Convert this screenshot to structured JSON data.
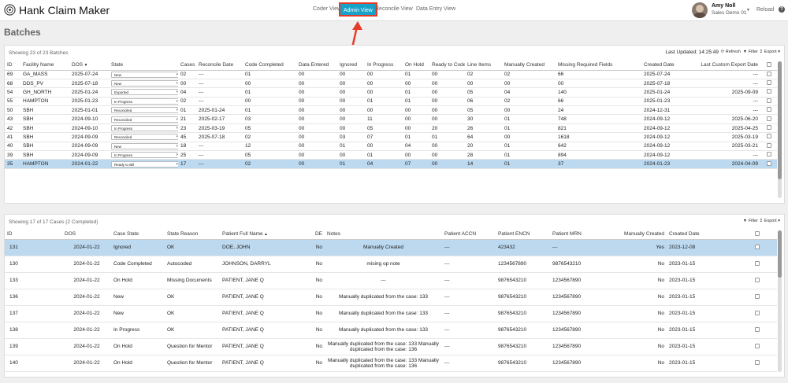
{
  "app": {
    "title": "Hank Claim Maker"
  },
  "nav": {
    "items": [
      {
        "label": "Coder View",
        "active": false
      },
      {
        "label": "Admin View",
        "active": true
      },
      {
        "label": "Reconcile View",
        "active": false
      },
      {
        "label": "Data Entry View",
        "active": false
      }
    ]
  },
  "user": {
    "name": "Amy Noll",
    "subtitle": "Sales Demo 01",
    "reload_label": "Reload",
    "help_label": "?"
  },
  "page": {
    "title": "Batches"
  },
  "batches": {
    "count_text": "Showing 23 of 23 Batches",
    "last_updated": "Last Updated: 14:25:49",
    "refresh_label": "Refresh",
    "filter_label": "Filter",
    "export_label": "Export",
    "columns": [
      "ID",
      "Facility Name",
      "DOS",
      "State",
      "Cases",
      "Reconcile Date",
      "Code Completed",
      "Data Entered",
      "Ignored",
      "In Progress",
      "On Hold",
      "Ready to Code",
      "Line Items",
      "Manually Created",
      "Missing Required Fields",
      "Created Date",
      "Last Custom Export Date"
    ],
    "rows": [
      {
        "id": "69",
        "facility": "GA_MASS",
        "dos": "2025-07-24",
        "state": "New",
        "cases": "02",
        "reconcile": "---",
        "code_completed": "01",
        "data_entered": "00",
        "ignored": "00",
        "in_progress": "00",
        "on_hold": "01",
        "ready_to_code": "00",
        "line_items": "02",
        "manually_created": "02",
        "missing": "66",
        "created": "2025-07-24",
        "last_export": "---",
        "selected": false
      },
      {
        "id": "68",
        "facility": "DDS_PV",
        "dos": "2025-07-18",
        "state": "New",
        "cases": "00",
        "reconcile": "---",
        "code_completed": "00",
        "data_entered": "00",
        "ignored": "00",
        "in_progress": "00",
        "on_hold": "00",
        "ready_to_code": "00",
        "line_items": "00",
        "manually_created": "00",
        "missing": "00",
        "created": "2025-07-18",
        "last_export": "---",
        "selected": false
      },
      {
        "id": "54",
        "facility": "GH_NORTH",
        "dos": "2025-01-24",
        "state": "Exported",
        "cases": "04",
        "reconcile": "---",
        "code_completed": "01",
        "data_entered": "00",
        "ignored": "00",
        "in_progress": "00",
        "on_hold": "01",
        "ready_to_code": "00",
        "line_items": "05",
        "manually_created": "04",
        "missing": "140",
        "created": "2025-01-24",
        "last_export": "2025-09-09",
        "selected": false
      },
      {
        "id": "55",
        "facility": "HAMPTON",
        "dos": "2025-01-23",
        "state": "In Progress",
        "cases": "02",
        "reconcile": "---",
        "code_completed": "00",
        "data_entered": "00",
        "ignored": "00",
        "in_progress": "01",
        "on_hold": "01",
        "ready_to_code": "00",
        "line_items": "06",
        "manually_created": "02",
        "missing": "66",
        "created": "2025-01-23",
        "last_export": "---",
        "selected": false
      },
      {
        "id": "50",
        "facility": "SBH",
        "dos": "2025-01-01",
        "state": "Reconciled",
        "cases": "01",
        "reconcile": "2025-01-24",
        "code_completed": "01",
        "data_entered": "00",
        "ignored": "00",
        "in_progress": "00",
        "on_hold": "00",
        "ready_to_code": "00",
        "line_items": "05",
        "manually_created": "00",
        "missing": "24",
        "created": "2024-12-31",
        "last_export": "---",
        "selected": false
      },
      {
        "id": "43",
        "facility": "SBH",
        "dos": "2024-09-10",
        "state": "Reconciled",
        "cases": "21",
        "reconcile": "2025-02-17",
        "code_completed": "03",
        "data_entered": "00",
        "ignored": "00",
        "in_progress": "11",
        "on_hold": "00",
        "ready_to_code": "00",
        "line_items": "30",
        "manually_created": "01",
        "missing": "748",
        "created": "2024-09-12",
        "last_export": "2025-06-20",
        "selected": false
      },
      {
        "id": "42",
        "facility": "SBH",
        "dos": "2024-09-10",
        "state": "In Progress",
        "cases": "23",
        "reconcile": "2025-03-19",
        "code_completed": "05",
        "data_entered": "00",
        "ignored": "00",
        "in_progress": "05",
        "on_hold": "00",
        "ready_to_code": "20",
        "line_items": "26",
        "manually_created": "01",
        "missing": "821",
        "created": "2024-09-12",
        "last_export": "2025-04-25",
        "selected": false
      },
      {
        "id": "41",
        "facility": "SBH",
        "dos": "2024-09-09",
        "state": "Reconciled",
        "cases": "45",
        "reconcile": "2025-07-18",
        "code_completed": "02",
        "data_entered": "00",
        "ignored": "03",
        "in_progress": "07",
        "on_hold": "01",
        "ready_to_code": "01",
        "line_items": "64",
        "manually_created": "00",
        "missing": "1618",
        "created": "2024-09-12",
        "last_export": "2025-03-19",
        "selected": false
      },
      {
        "id": "40",
        "facility": "SBH",
        "dos": "2024-09-09",
        "state": "New",
        "cases": "18",
        "reconcile": "---",
        "code_completed": "12",
        "data_entered": "00",
        "ignored": "01",
        "in_progress": "00",
        "on_hold": "04",
        "ready_to_code": "00",
        "line_items": "20",
        "manually_created": "01",
        "missing": "642",
        "created": "2024-09-12",
        "last_export": "2025-03-21",
        "selected": false
      },
      {
        "id": "39",
        "facility": "SBH",
        "dos": "2024-09-09",
        "state": "In Progress",
        "cases": "25",
        "reconcile": "---",
        "code_completed": "05",
        "data_entered": "00",
        "ignored": "00",
        "in_progress": "01",
        "on_hold": "00",
        "ready_to_code": "00",
        "line_items": "28",
        "manually_created": "01",
        "missing": "894",
        "created": "2024-09-12",
        "last_export": "---",
        "selected": false
      },
      {
        "id": "35",
        "facility": "HAMPTON",
        "dos": "2024-01-22",
        "state": "Ready to Bill",
        "cases": "17",
        "reconcile": "---",
        "code_completed": "02",
        "data_entered": "00",
        "ignored": "01",
        "in_progress": "04",
        "on_hold": "07",
        "ready_to_code": "00",
        "line_items": "14",
        "manually_created": "01",
        "missing": "37",
        "created": "2024-01-23",
        "last_export": "2024-04-09",
        "selected": true
      }
    ]
  },
  "cases": {
    "count_text": "Showing 17 of 17 Cases (2 Completed)",
    "filter_label": "Filter",
    "export_label": "Export",
    "columns": [
      "ID",
      "DOS",
      "Case State",
      "State Reason",
      "Patient Full Name",
      "DE",
      "Notes",
      "Patient ACCN",
      "Patient ENCN",
      "Patient MRN",
      "Manually Created",
      "Created Date"
    ],
    "rows": [
      {
        "id": "131",
        "dos": "2024-01-22",
        "state": "Ignored",
        "reason": "OK",
        "patient": "DOE, JOHN",
        "de": "No",
        "notes": "Manually Created",
        "accn": "---",
        "encn": "423432",
        "mrn": "---",
        "manual": "Yes",
        "created": "2023-12-08",
        "selected": true
      },
      {
        "id": "130",
        "dos": "2024-01-22",
        "state": "Code Completed",
        "reason": "Autocoded",
        "patient": "JOHNSON, DARRYL",
        "de": "No",
        "notes": "mising op note",
        "accn": "---",
        "encn": "1234567890",
        "mrn": "9876543210",
        "manual": "No",
        "created": "2023-01-15",
        "selected": false
      },
      {
        "id": "133",
        "dos": "2024-01-22",
        "state": "On Hold",
        "reason": "Missing Documents",
        "patient": "PATIENT, JANE Q",
        "de": "No",
        "notes": "---",
        "accn": "---",
        "encn": "9876543210",
        "mrn": "1234567890",
        "manual": "No",
        "created": "2023-01-15",
        "selected": false
      },
      {
        "id": "136",
        "dos": "2024-01-22",
        "state": "New",
        "reason": "OK",
        "patient": "PATIENT, JANE Q",
        "de": "No",
        "notes": "Manually duplicated from the case: 133",
        "accn": "---",
        "encn": "9876543210",
        "mrn": "1234567890",
        "manual": "No",
        "created": "2023-01-15",
        "selected": false
      },
      {
        "id": "137",
        "dos": "2024-01-22",
        "state": "New",
        "reason": "OK",
        "patient": "PATIENT, JANE Q",
        "de": "No",
        "notes": "Manually duplicated from the case: 133",
        "accn": "---",
        "encn": "9876543210",
        "mrn": "1234567890",
        "manual": "No",
        "created": "2023-01-15",
        "selected": false
      },
      {
        "id": "138",
        "dos": "2024-01-22",
        "state": "In Progress",
        "reason": "OK",
        "patient": "PATIENT, JANE Q",
        "de": "No",
        "notes": "Manually duplicated from the case: 133",
        "accn": "---",
        "encn": "9876543210",
        "mrn": "1234567890",
        "manual": "No",
        "created": "2023-01-15",
        "selected": false
      },
      {
        "id": "139",
        "dos": "2024-01-22",
        "state": "On Hold",
        "reason": "Question for Mentor",
        "patient": "PATIENT, JANE Q",
        "de": "No",
        "notes": "Manually duplicated from the case: 133 Manually duplicated from the case: 136",
        "accn": "---",
        "encn": "9876543210",
        "mrn": "1234567890",
        "manual": "No",
        "created": "2023-01-15",
        "selected": false
      },
      {
        "id": "140",
        "dos": "2024-01-22",
        "state": "On Hold",
        "reason": "Question for Mentor",
        "patient": "PATIENT, JANE Q",
        "de": "No",
        "notes": "Manually duplicated from the case: 133 Manually duplicated from the case: 136",
        "accn": "---",
        "encn": "9876543210",
        "mrn": "1234567890",
        "manual": "No",
        "created": "2023-01-15",
        "selected": false
      }
    ]
  },
  "colors": {
    "accent": "#17a2c8",
    "highlight": "#e53b2a",
    "selected_row": "#bcd9f0"
  }
}
